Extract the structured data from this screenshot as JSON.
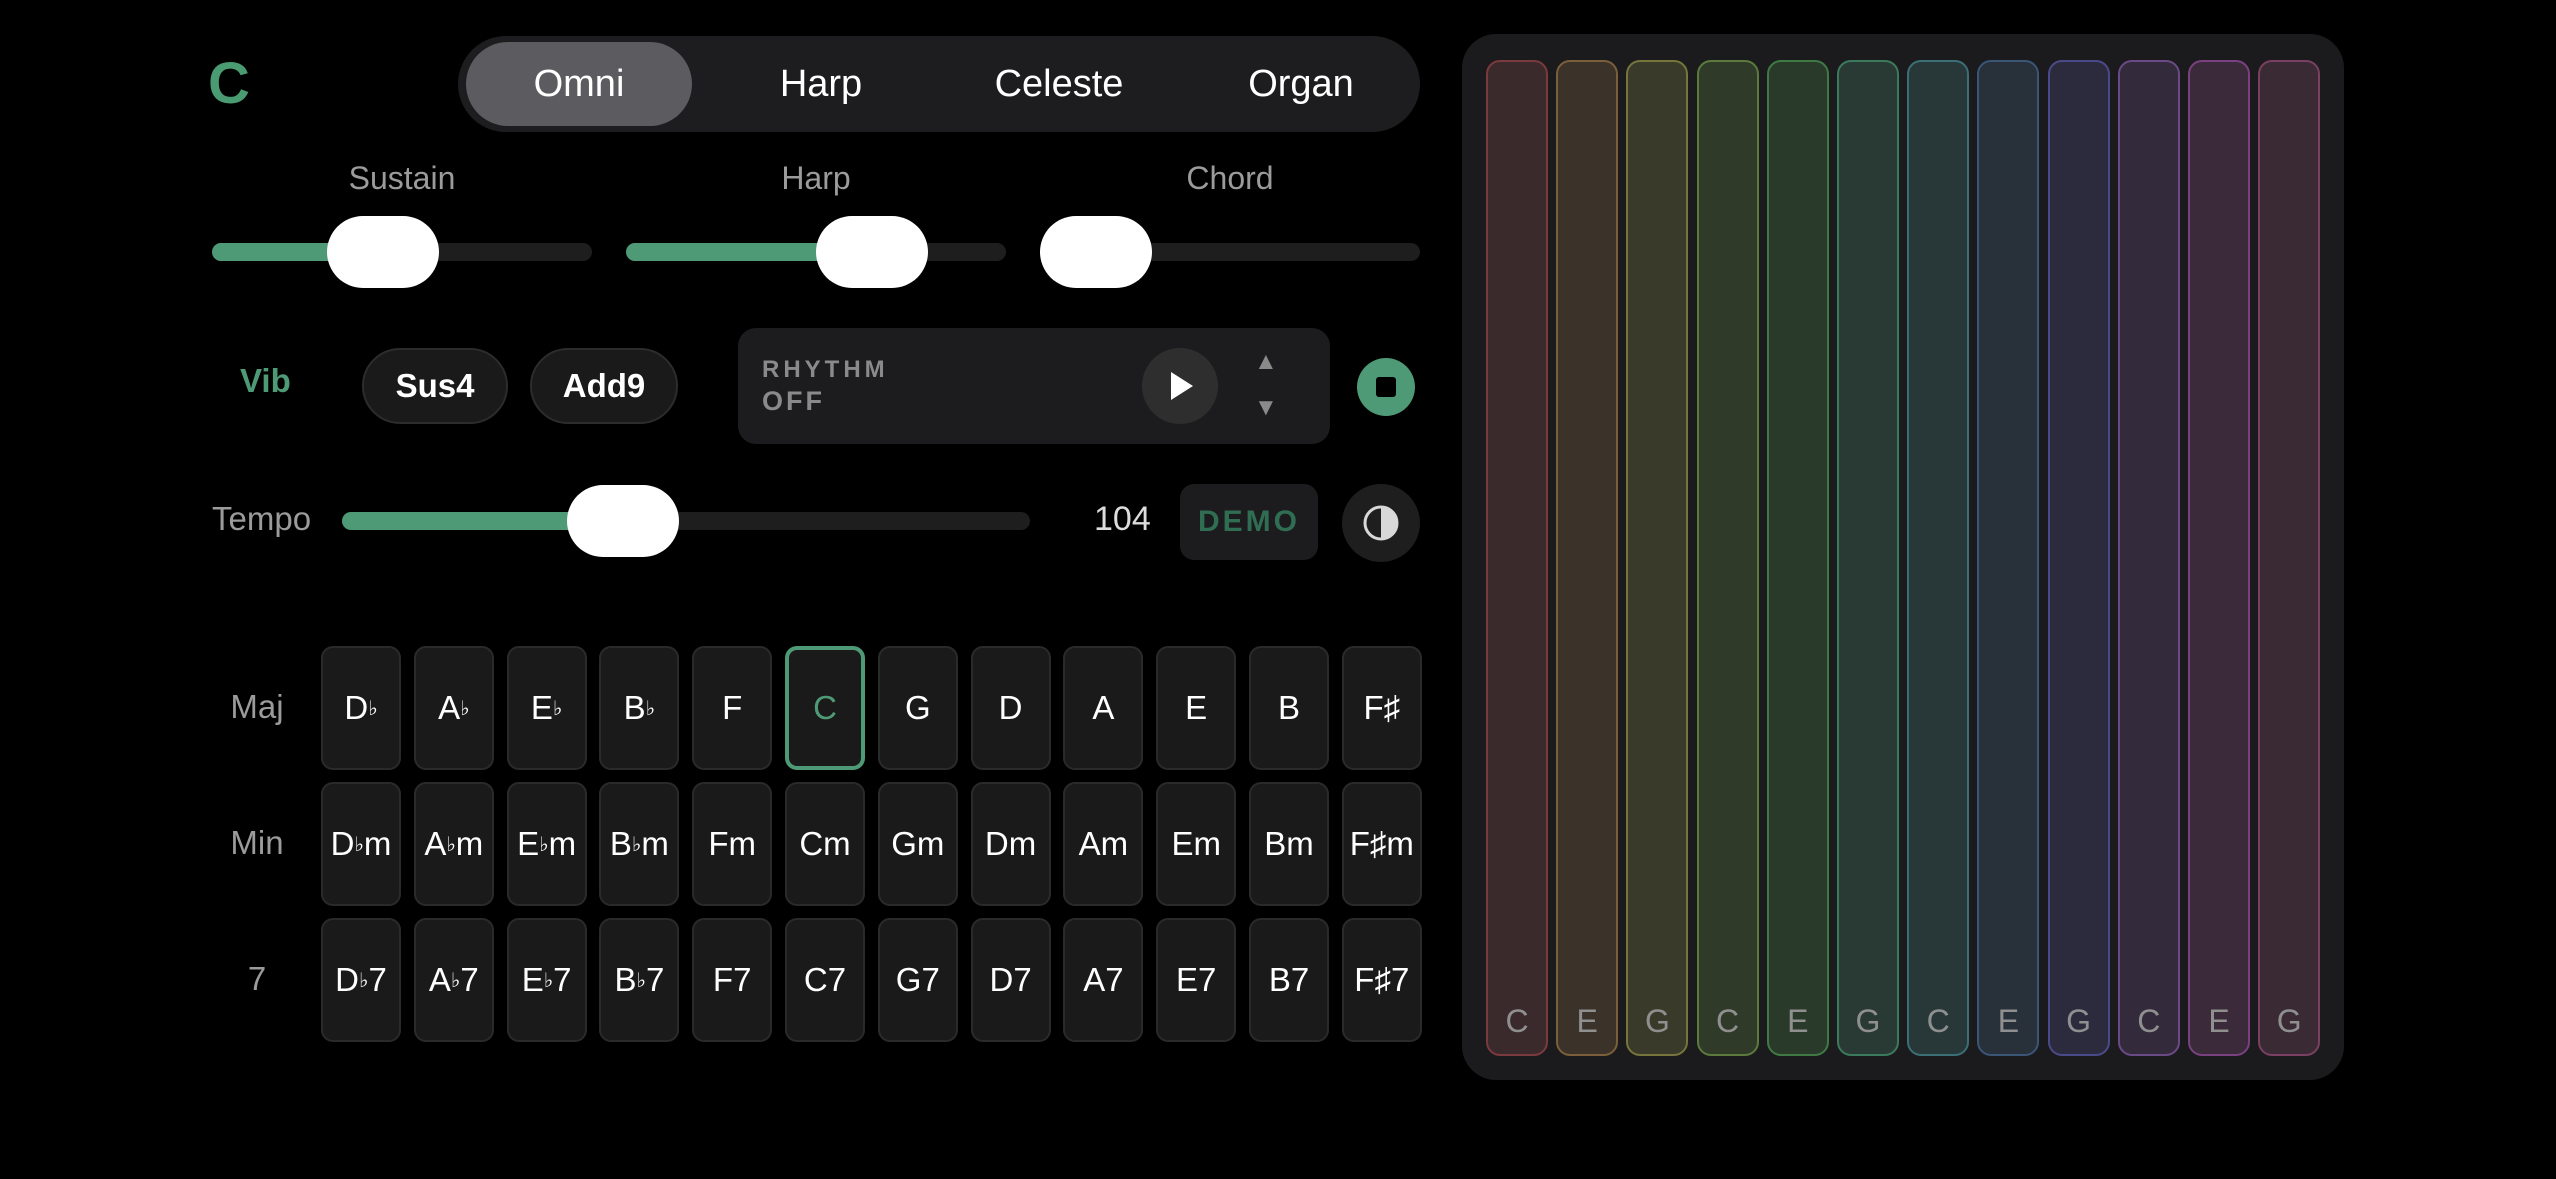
{
  "key": "C",
  "instruments": [
    {
      "label": "Omni",
      "active": true
    },
    {
      "label": "Harp",
      "active": false
    },
    {
      "label": "Celeste",
      "active": false
    },
    {
      "label": "Organ",
      "active": false
    }
  ],
  "sliders": {
    "sustain": {
      "label": "Sustain",
      "value": 0.43
    },
    "harp": {
      "label": "Harp",
      "value": 0.71
    },
    "chord": {
      "label": "Chord",
      "value": 0.0
    }
  },
  "toggles": {
    "vib": "Vib",
    "sus4": "Sus4",
    "add9": "Add9"
  },
  "rhythm": {
    "title": "RHYTHM",
    "state": "OFF",
    "up": "▲",
    "down": "▼"
  },
  "tempo": {
    "label": "Tempo",
    "value": "104",
    "fraction": 0.39
  },
  "demo_label": "DEMO",
  "chord_rows": [
    {
      "label": "Maj",
      "chords": [
        "D♭",
        "A♭",
        "E♭",
        "B♭",
        "F",
        "C",
        "G",
        "D",
        "A",
        "E",
        "B",
        "F♯"
      ]
    },
    {
      "label": "Min",
      "chords": [
        "D♭m",
        "A♭m",
        "E♭m",
        "B♭m",
        "Fm",
        "Cm",
        "Gm",
        "Dm",
        "Am",
        "Em",
        "Bm",
        "F♯m"
      ]
    },
    {
      "label": "7",
      "chords": [
        "D♭7",
        "A♭7",
        "E♭7",
        "B♭7",
        "F7",
        "C7",
        "G7",
        "D7",
        "A7",
        "E7",
        "B7",
        "F♯7"
      ]
    }
  ],
  "selected_chord": "C",
  "strings": [
    {
      "note": "C",
      "border": "#7a3a3e",
      "fill": "#3a2a2b"
    },
    {
      "note": "E",
      "border": "#7a5f3a",
      "fill": "#3b322a"
    },
    {
      "note": "G",
      "border": "#75753c",
      "fill": "#393a2a"
    },
    {
      "note": "C",
      "border": "#5b7a3c",
      "fill": "#2f3a29"
    },
    {
      "note": "E",
      "border": "#3f7a44",
      "fill": "#293a2b"
    },
    {
      "note": "G",
      "border": "#3b7a5c",
      "fill": "#283a33"
    },
    {
      "note": "C",
      "border": "#3b6f76",
      "fill": "#283839"
    },
    {
      "note": "E",
      "border": "#3b5577",
      "fill": "#283039"
    },
    {
      "note": "G",
      "border": "#4a4a8a",
      "fill": "#2c2b3e"
    },
    {
      "note": "C",
      "border": "#6a4a86",
      "fill": "#332a3c"
    },
    {
      "note": "E",
      "border": "#7a4080",
      "fill": "#3a2a3a"
    },
    {
      "note": "G",
      "border": "#7a3f62",
      "fill": "#3a2a33"
    }
  ],
  "colors": {
    "accent": "#4f9a76",
    "background": "#000000",
    "panel": "#1b1b1d"
  }
}
